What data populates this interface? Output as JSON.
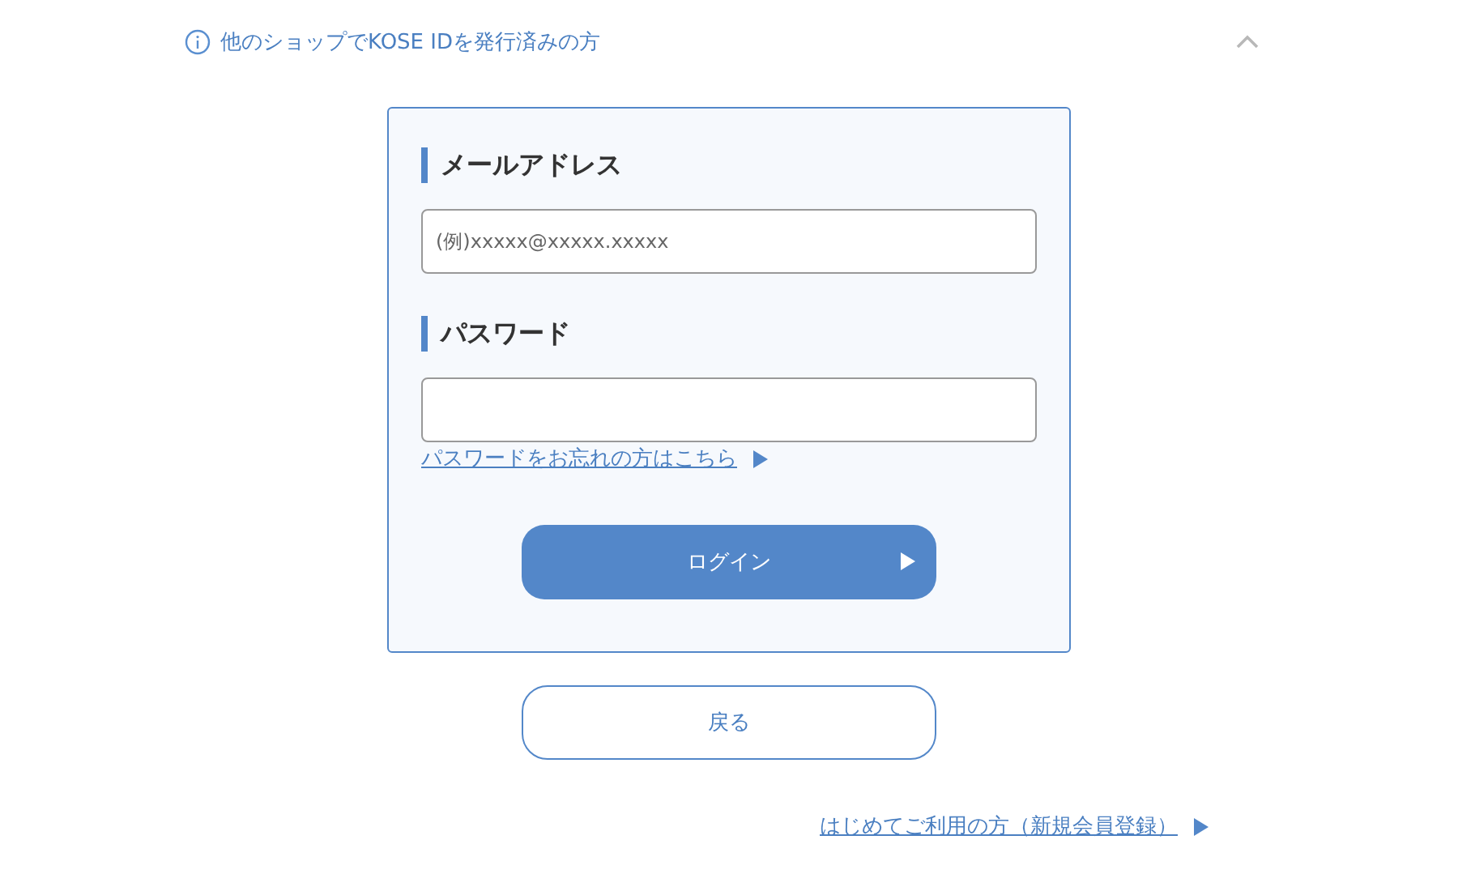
{
  "section_toggle": {
    "label": "他のショップでKOSE IDを発行済みの方",
    "expanded": true
  },
  "form": {
    "email": {
      "label": "メールアドレス",
      "placeholder": "(例)xxxxx@xxxxx.xxxxx"
    },
    "password": {
      "label": "パスワード"
    },
    "forgot_link": "パスワードをお忘れの方はこちら",
    "login_button": "ログイン"
  },
  "back_button": "戻る",
  "register_link": "はじめてご利用の方（新規会員登録）"
}
